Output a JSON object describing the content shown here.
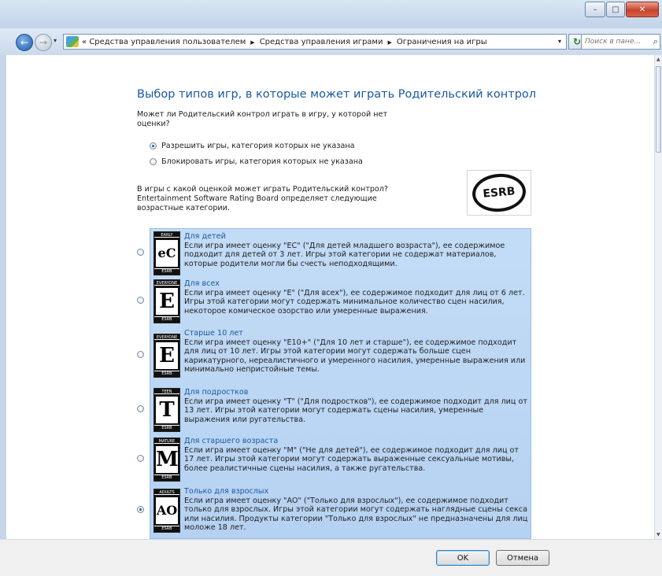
{
  "window": {
    "min": "–",
    "max": "□",
    "close": "✕"
  },
  "nav": {
    "chevron": "«",
    "breadcrumbs": [
      "Средства управления пользователем",
      "Средства управления играми",
      "Ограничения на игры"
    ],
    "search_placeholder": "Поиск в пане..."
  },
  "page": {
    "heading": "Выбор типов игр, в которые может играть Родительский контрол",
    "question1": "Может ли Родительский контрол играть в игру, у которой нет оценки?",
    "option_allow": "Разрешить игры, категория которых не указана",
    "option_block": "Блокировать игры, категория которых не указана",
    "question2": "В игры с какой оценкой может играть Родительский контрол? Entertainment Software Rating Board определяет следующие возрастные категории.",
    "esrb_logo": "ESRB"
  },
  "ratings": [
    {
      "badge": "eC",
      "cap": "EARLY CHILDHOOD",
      "title": "Для детей",
      "desc": "Если игра имеет оценку \"EC\" (\"Для детей младшего возраста\"), ее содержимое подходит для детей от 3 лет. Игры этой категории не содержат материалов, которые родители могли бы счесть неподходящими.",
      "selected": false
    },
    {
      "badge": "E",
      "cap": "EVERYONE",
      "title": "Для всех",
      "desc": "Если игра имеет оценку \"E\" (\"Для всех\"), ее содержимое подходит для лиц от 6 лет. Игры этой категории могут содержать минимальное количество сцен насилия, некоторое комическое озорство или умеренные выражения.",
      "selected": false
    },
    {
      "badge": "E",
      "cap": "EVERYONE 10+",
      "title": "Старше 10 лет",
      "desc": "Если игра имеет оценку \"E10+\" (\"Для 10 лет и старше\"), ее содержимое подходит для лиц от 10 лет. Игры этой категории могут содержать больше сцен карикатурного, нереалистичного и умеренного насилия, умеренные выражения или минимально непристойные темы.",
      "selected": false
    },
    {
      "badge": "T",
      "cap": "TEEN",
      "title": "Для подростков",
      "desc": "Если игра имеет оценку \"T\" (\"Для подростков\"), ее содержимое подходит для лиц от 13 лет. Игры этой категории могут содержать сцены насилия, умеренные выражения или ругательства.",
      "selected": false
    },
    {
      "badge": "M",
      "cap": "MATURE 17+",
      "title": "Для старшего возраста",
      "desc": "Если игра имеет оценку \"M\" (\"Не для детей\"), ее содержимое подходит для лиц от 17 лет. Игры этой категории могут содержать выраженные сексуальные мотивы, более реалистичные сцены насилия, а также ругательства.",
      "selected": false
    },
    {
      "badge": "AO",
      "cap": "ADULTS ONLY 18+",
      "title": "Только для взрослых",
      "desc": "Если игра имеет оценку \"AO\" (\"Только для взрослых\"), ее содержимое подходит только для взрослых. Игры этой категории могут содержать наглядные сцены секса или насилия. Продукты категории \"Только для взрослых\" не предназначены для лиц моложе 18 лет.",
      "selected": true
    }
  ],
  "buttons": {
    "ok": "OK",
    "cancel": "Отмена"
  }
}
